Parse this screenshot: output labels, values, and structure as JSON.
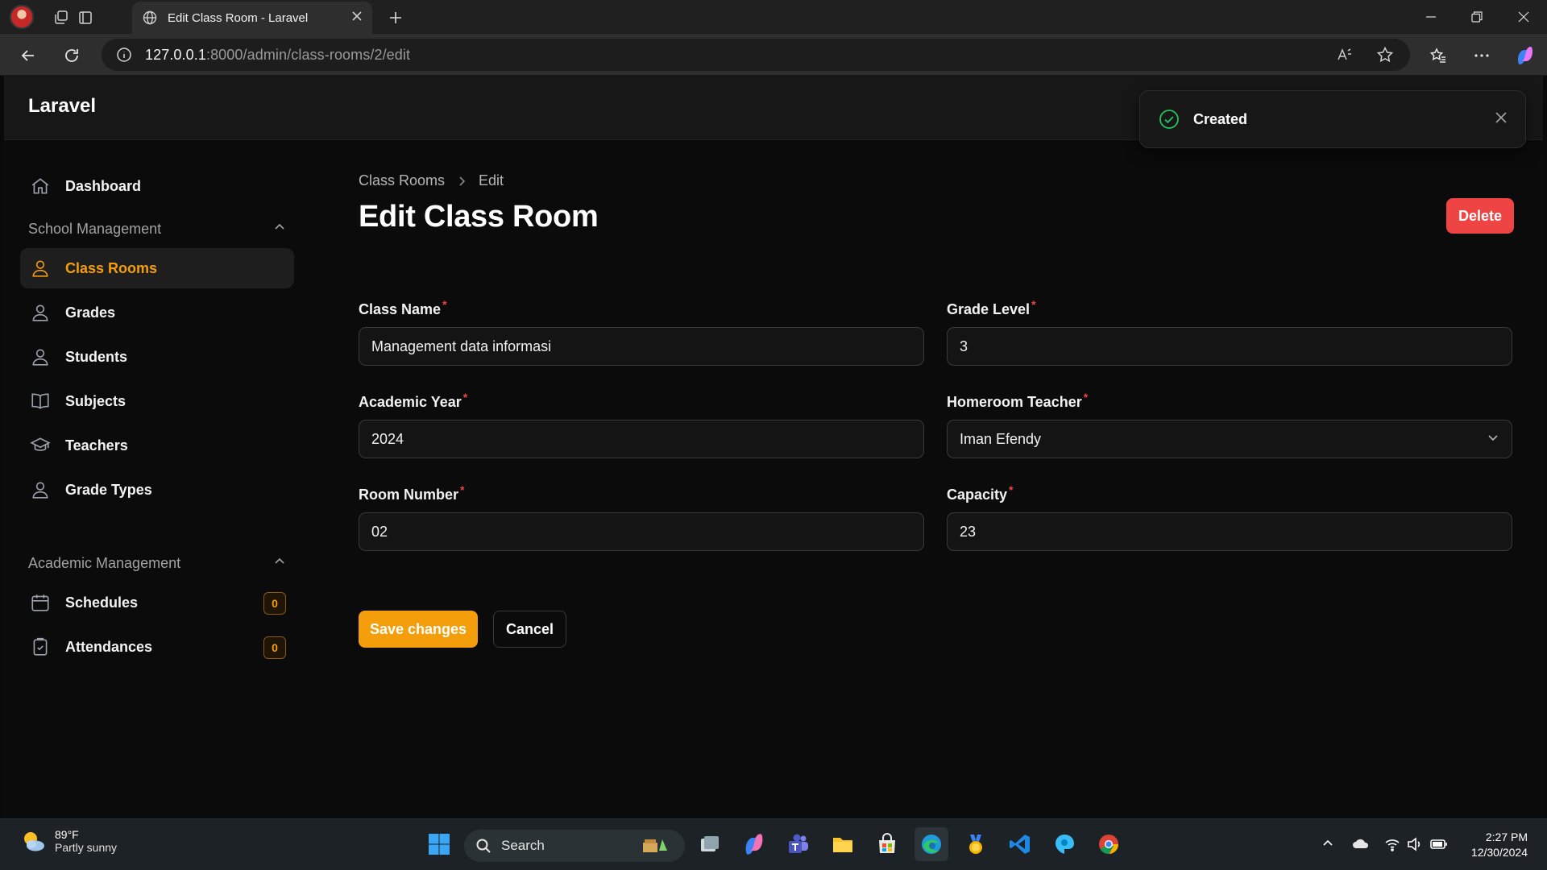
{
  "browser": {
    "tab_title": "Edit Class Room - Laravel",
    "url_host": "127.0.0.1",
    "url_rest": ":8000/admin/class-rooms/2/edit"
  },
  "app": {
    "brand": "Laravel"
  },
  "toast": {
    "title": "Created",
    "color": "#22c55e"
  },
  "sidebar": {
    "dashboard": "Dashboard",
    "group_school": "School Management",
    "school_items": [
      {
        "label": "Class Rooms",
        "icon": "user-icon",
        "active": true
      },
      {
        "label": "Grades",
        "icon": "user-icon"
      },
      {
        "label": "Students",
        "icon": "user-icon"
      },
      {
        "label": "Subjects",
        "icon": "book-icon"
      },
      {
        "label": "Teachers",
        "icon": "academic-cap-icon"
      },
      {
        "label": "Grade Types",
        "icon": "user-icon"
      }
    ],
    "group_academic": "Academic Management",
    "academic_items": [
      {
        "label": "Schedules",
        "icon": "calendar-icon",
        "badge": "0"
      },
      {
        "label": "Attendances",
        "icon": "clipboard-icon",
        "badge": "0"
      }
    ]
  },
  "main": {
    "breadcrumb": [
      "Class Rooms",
      "Edit"
    ],
    "title": "Edit Class Room",
    "delete_label": "Delete",
    "fields": {
      "class_name": {
        "label": "Class Name",
        "value": "Management data informasi"
      },
      "grade_level": {
        "label": "Grade Level",
        "value": "3"
      },
      "academic_year": {
        "label": "Academic Year",
        "value": "2024"
      },
      "homeroom_teacher": {
        "label": "Homeroom Teacher",
        "value": "Iman Efendy"
      },
      "room_number": {
        "label": "Room Number",
        "value": "02"
      },
      "capacity": {
        "label": "Capacity",
        "value": "23"
      }
    },
    "save_label": "Save changes",
    "cancel_label": "Cancel"
  },
  "colors": {
    "accent": "#f59e0b",
    "danger": "#ef4444",
    "required": "#ef4444"
  },
  "taskbar": {
    "weather_temp": "89°F",
    "weather_desc": "Partly sunny",
    "search_label": "Search",
    "time": "2:27 PM",
    "date": "12/30/2024"
  }
}
